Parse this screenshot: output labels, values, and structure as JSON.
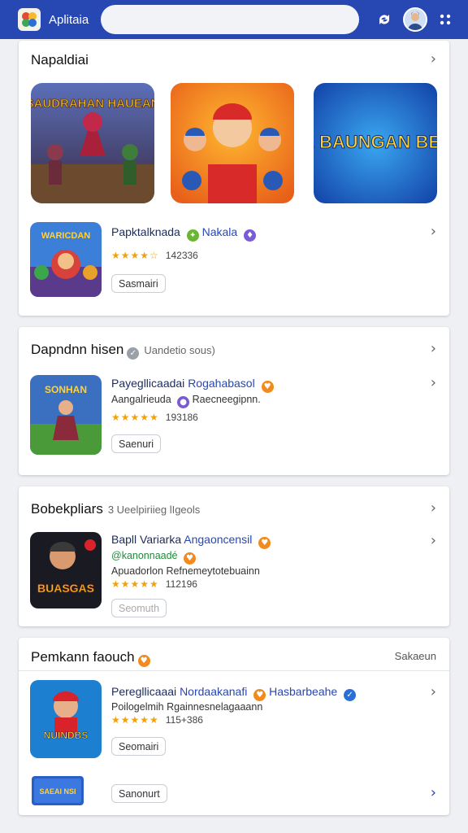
{
  "header": {
    "app_name": "Aplitaia",
    "search_placeholder": ""
  },
  "sections": [
    {
      "title": "Napaldiai",
      "featured_titles": [
        "SAUDRAHAN HAUEAN",
        "THE BAUNGAN BESMI"
      ],
      "app": {
        "icon_text": "WARICDAN",
        "title": "Papktalknada",
        "developer": "Nakala",
        "rating": "★★★★☆",
        "count": "142336",
        "button": "Sasmairi"
      }
    },
    {
      "title": "Dapndnn hisen",
      "subtitle": "Uandetio sous)",
      "app": {
        "icon_text": "SONHAN",
        "title": "Payegllicaadai",
        "developer": "Rogahabasol",
        "line": "Aangalrieuda",
        "line2": "Raecneegipnn.",
        "rating": "★★★★★",
        "count": "193186",
        "button": "Saenuri"
      }
    },
    {
      "title": "Bobekpliars",
      "subtitle": "3 Ueelpiriieg lIgeols",
      "app": {
        "icon_text": "BUASGAS",
        "title": "Bapll Variarka",
        "developer": "Angaoncensil",
        "green_line": "@kanonnaadé",
        "line": "Apuadorlon",
        "line2": "Refnemeytotebuainn",
        "rating": "★★★★★",
        "count": "112196",
        "button": "Seomuth"
      }
    },
    {
      "title": "Pemkann faouch",
      "see_more": "Sakaeun",
      "app": {
        "icon_text": "NUINDBS",
        "title": "Peregllicaaai",
        "developer": "Nordaakanafi",
        "developer2": "Hasbarbeahe",
        "line": "Poilogelmih",
        "line2": "Rgainnesnelagaaann",
        "rating": "★★★★★",
        "count": "115+386",
        "button": "Seomairi"
      },
      "extra": {
        "icon_text": "SAEAI NSI",
        "button": "Sanonurt"
      }
    }
  ],
  "colors": {
    "header_bg": "#2747b3",
    "star": "#f2a10a",
    "developer": "#2747b3"
  }
}
